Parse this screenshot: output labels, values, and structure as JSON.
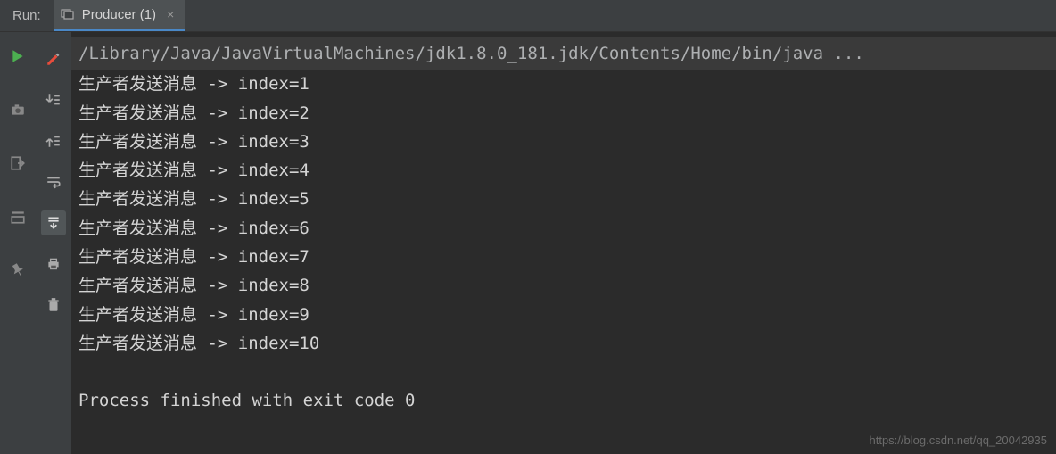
{
  "header": {
    "run_label": "Run:",
    "tab": {
      "title": "Producer (1)",
      "close": "×"
    }
  },
  "console": {
    "command": "/Library/Java/JavaVirtualMachines/jdk1.8.0_181.jdk/Contents/Home/bin/java ...",
    "lines": [
      "生产者发送消息 -> index=1",
      "生产者发送消息 -> index=2",
      "生产者发送消息 -> index=3",
      "生产者发送消息 -> index=4",
      "生产者发送消息 -> index=5",
      "生产者发送消息 -> index=6",
      "生产者发送消息 -> index=7",
      "生产者发送消息 -> index=8",
      "生产者发送消息 -> index=9",
      "生产者发送消息 -> index=10"
    ],
    "exit_message": "Process finished with exit code 0"
  },
  "watermark": "https://blog.csdn.net/qq_20042935"
}
